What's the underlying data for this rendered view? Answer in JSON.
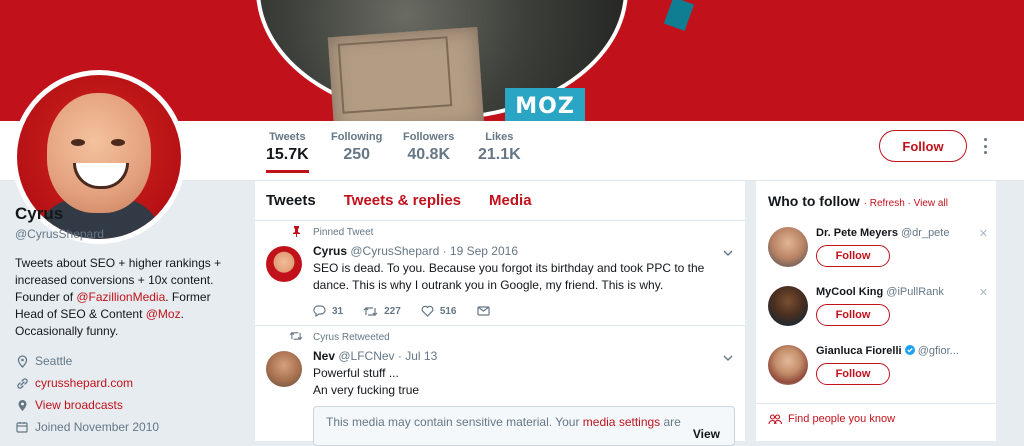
{
  "banner": {
    "brand_text": "MOZ"
  },
  "nav": {
    "stats": [
      {
        "label": "Tweets",
        "value": "15.7K"
      },
      {
        "label": "Following",
        "value": "250"
      },
      {
        "label": "Followers",
        "value": "40.8K"
      },
      {
        "label": "Likes",
        "value": "21.1K"
      }
    ],
    "follow_label": "Follow"
  },
  "profile": {
    "name": "Cyrus",
    "handle": "@CyrusShepard",
    "bio_1": "Tweets about SEO + higher rankings + increased conversions + 10x content. Founder of ",
    "bio_link_1": "@FazillionMedia",
    "bio_2": ". Former Head of SEO & Content ",
    "bio_link_2": "@Moz",
    "bio_3": ". Occasionally funny.",
    "location": "Seattle",
    "website": "cyrusshepard.com",
    "broadcasts": "View broadcasts",
    "joined": "Joined November 2010"
  },
  "timeline": {
    "tabs": [
      "Tweets",
      "Tweets & replies",
      "Media"
    ],
    "tweets": [
      {
        "context": "Pinned Tweet",
        "name": "Cyrus",
        "handle": "@CyrusShepard",
        "date": "· 19 Sep 2016",
        "text": "SEO is dead. To you. Because you forgot its birthday and took PPC to the dance. This is why I outrank you in Google, my friend. This is why.",
        "replies": "31",
        "retweets": "227",
        "likes": "516"
      },
      {
        "context": "Cyrus Retweeted",
        "name": "Nev",
        "handle": "@LFCNev",
        "date": "· Jul 13",
        "text_1": "Powerful stuff ...",
        "text_2": "An very fucking true",
        "sensitive_1": "This media may contain sensitive material. Your ",
        "sensitive_link": "media settings",
        "sensitive_2": " are",
        "view": "View"
      }
    ]
  },
  "who_to_follow": {
    "title": "Who to follow",
    "refresh": "· Refresh",
    "view_all": "· View all",
    "suggestions": [
      {
        "name": "Dr. Pete Meyers",
        "handle": "@dr_pete",
        "button": "Follow"
      },
      {
        "name": "MyCool King",
        "handle": "@iPullRank",
        "button": "Follow"
      },
      {
        "name": "Gianluca Fiorelli",
        "handle": "@gfior...",
        "button": "Follow"
      }
    ],
    "find": "Find people you know"
  },
  "colors": {
    "accent": "#c1121c",
    "muted": "#657786",
    "text": "#14171a"
  }
}
